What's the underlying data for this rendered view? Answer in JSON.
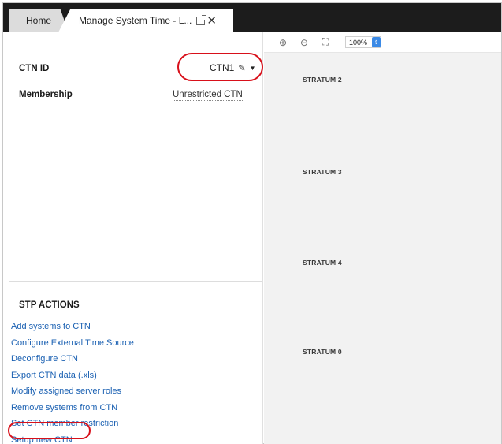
{
  "tabs": {
    "home": "Home",
    "manage": "Manage System Time - L..."
  },
  "ctn": {
    "label": "CTN ID",
    "value": "CTN1"
  },
  "membership": {
    "label": "Membership",
    "value": "Unrestricted CTN"
  },
  "stp_actions": {
    "title": "STP ACTIONS",
    "items": [
      "Add systems to CTN",
      "Configure External Time Source",
      "Deconfigure CTN",
      "Export CTN data (.xls)",
      "Modify assigned server roles",
      "Remove systems from CTN",
      "Set CTN member restriction",
      "Setup new CTN"
    ]
  },
  "canvas": {
    "zoom": "100%",
    "strata": [
      "STRATUM 2",
      "STRATUM 3",
      "STRATUM 4",
      "STRATUM 0"
    ]
  },
  "icons": {
    "zoom_in": "zoom-in-icon",
    "zoom_out": "zoom-out-icon",
    "fit": "fit-to-screen-icon",
    "pencil": "pencil-icon",
    "caret": "caret-down-icon",
    "popout": "popout-icon",
    "close": "close-icon"
  },
  "colors": {
    "link": "#1a60b2",
    "highlight": "#d8101a",
    "tabbar": "#1c1c1c"
  }
}
